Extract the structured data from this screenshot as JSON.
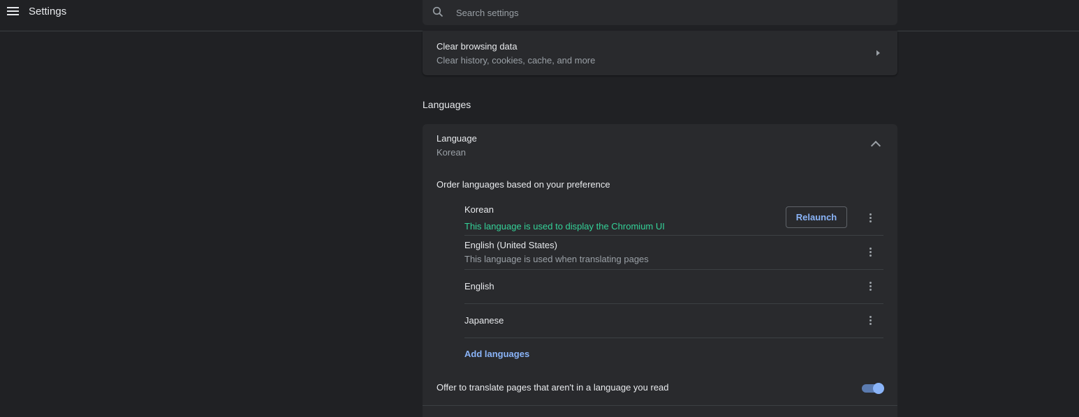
{
  "header": {
    "title": "Settings",
    "search_placeholder": "Search settings"
  },
  "privacy": {
    "clear_title": "Clear browsing data",
    "clear_subtitle": "Clear history, cookies, cache, and more"
  },
  "languages": {
    "section_title": "Languages",
    "language_title": "Language",
    "language_value": "Korean",
    "order_label": "Order languages based on your preference",
    "items": [
      {
        "name": "Korean",
        "note": "This language is used to display the Chromium UI",
        "action": "Relaunch"
      },
      {
        "name": "English (United States)",
        "note": "This language is used when translating pages"
      },
      {
        "name": "English"
      },
      {
        "name": "Japanese"
      }
    ],
    "add_label": "Add languages",
    "offer_translate_label": "Offer to translate pages that aren't in a language you read",
    "offer_translate_enabled": true
  },
  "colors": {
    "background": "#202124",
    "card": "#292a2d",
    "accent": "#8ab4f8",
    "success_note": "#34d399"
  },
  "icons": [
    "menu-icon",
    "search-icon",
    "chevron-right-icon",
    "chevron-up-icon",
    "more-vert-icon"
  ]
}
